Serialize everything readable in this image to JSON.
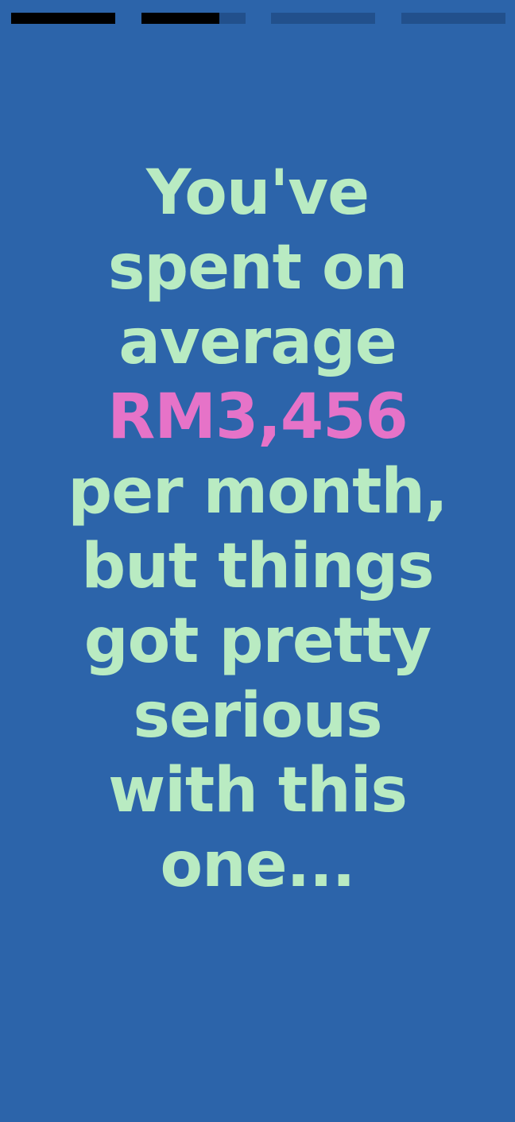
{
  "colors": {
    "background": "#2c64aa",
    "text": "#b9ebc2",
    "highlight": "#e673c8",
    "progress_track": "#22508c",
    "progress_fill": "#000000"
  },
  "progress": [
    {
      "fill": 1.0
    },
    {
      "fill": 0.75
    },
    {
      "fill": 0.0
    },
    {
      "fill": 0.0
    }
  ],
  "story": {
    "lines": [
      "You've",
      "spent on",
      "average",
      "RM3,456",
      "per month,",
      "but things",
      "got pretty",
      "serious",
      "with this",
      "one..."
    ]
  }
}
